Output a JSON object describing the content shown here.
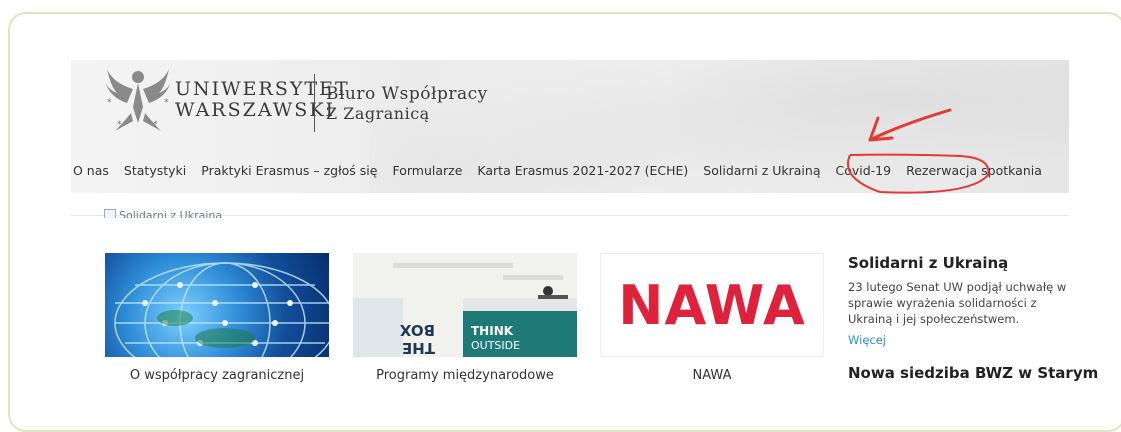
{
  "branding": {
    "university_line1": "UNIWERSYTET",
    "university_line2": "WARSZAWSKI",
    "office_line1": "Biuro Współpracy",
    "office_line2": "Z Zagranicą",
    "logo": "eagle-crest-icon"
  },
  "nav": {
    "items": [
      {
        "label": "O nas"
      },
      {
        "label": "Statystyki"
      },
      {
        "label": "Praktyki Erasmus – zgłoś się"
      },
      {
        "label": "Formularze"
      },
      {
        "label": "Karta Erasmus 2021-2027 (ECHE)"
      },
      {
        "label": "Solidarni z Ukrainą"
      },
      {
        "label": "Covid-19"
      },
      {
        "label": "Rezerwacja spotkania"
      }
    ]
  },
  "banner": {
    "alt_text": "Solidarni z Ukraina"
  },
  "cards": [
    {
      "label": "O współpracy zagranicznej",
      "image": "globe-network-image"
    },
    {
      "label": "Programy międzynarodowe",
      "image": "think-outside-the-box-image",
      "sign1": "THINK",
      "sign2": "OUTSIDE",
      "sign3": "BOX",
      "sign4": "THE"
    },
    {
      "label": "NAWA",
      "image": "nawa-logo",
      "logo_text": "NAWA"
    }
  ],
  "sidebar": {
    "news1_title": "Solidarni z Ukrainą",
    "news1_body": "23 lutego Senat UW podjął uchwałę w sprawie wyrażenia solidarności z Ukrainą i jej społeczeństwem.",
    "news1_link": "Więcej",
    "news2_title": "Nowa siedziba BWZ w Starym"
  },
  "colors": {
    "annotation": "#e53935",
    "nawa_red": "#e0213b",
    "link": "#2a8fd0"
  }
}
